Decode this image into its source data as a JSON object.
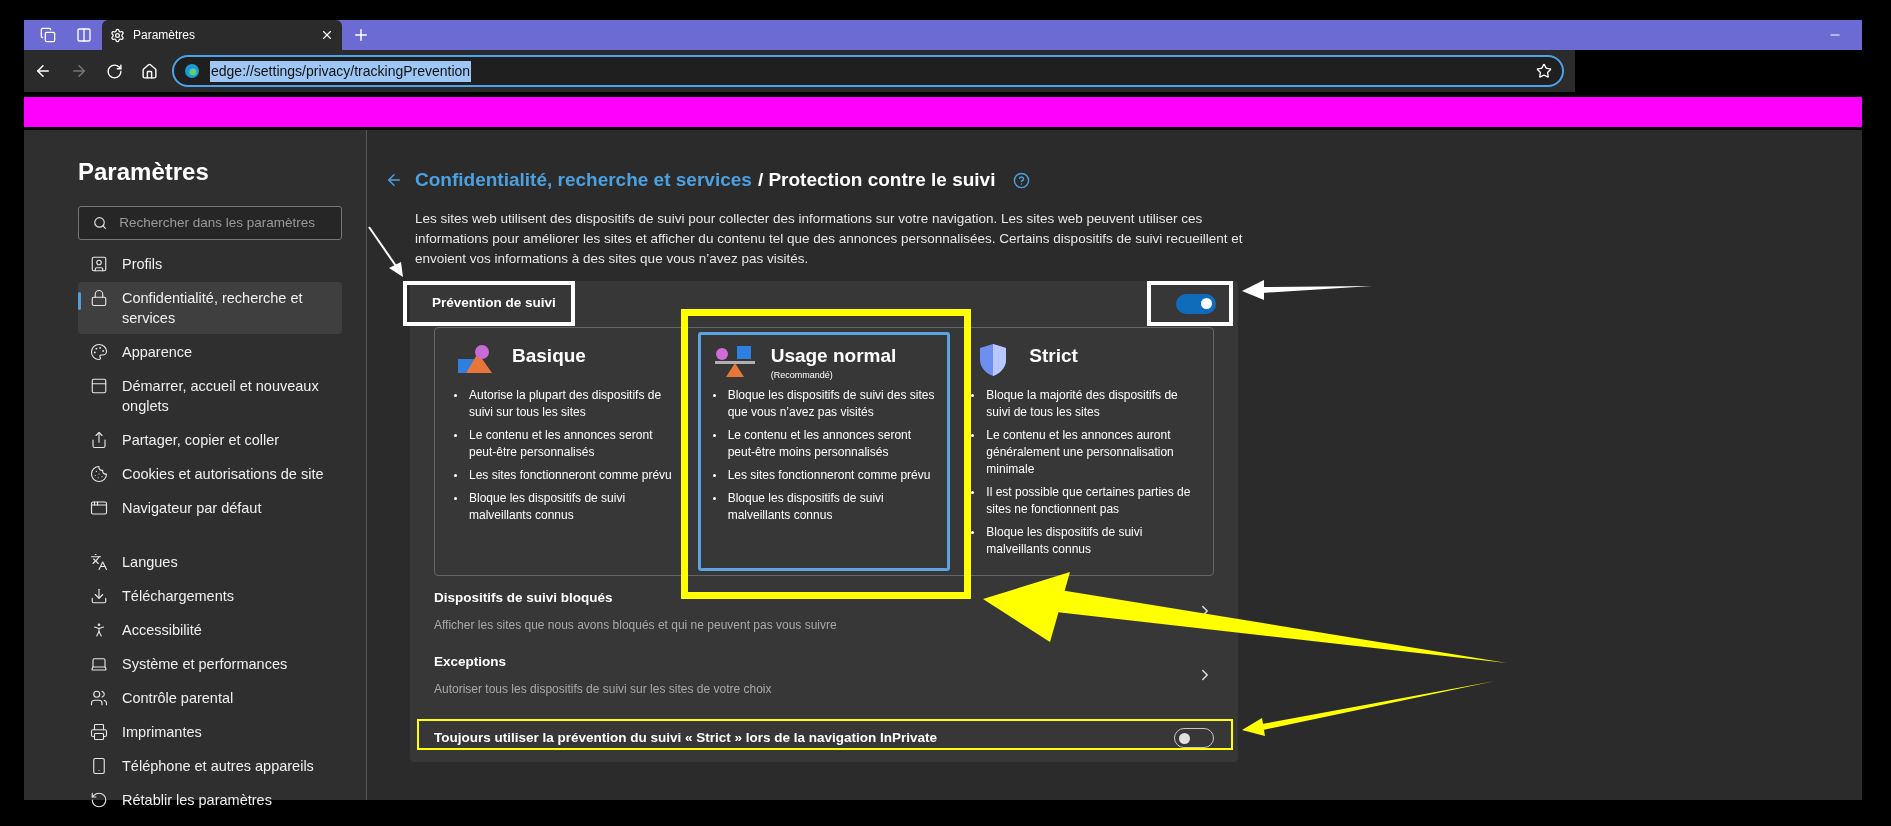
{
  "browser": {
    "tabs": [
      {
        "label": "Paramètres",
        "selected": true
      }
    ],
    "address": {
      "value": "edge://settings/privacy/trackingPrevention",
      "highlighted": true
    }
  },
  "sidebar": {
    "title": "Paramètres",
    "search": {
      "placeholder": "Rechercher dans les paramètres"
    },
    "groups": [
      [
        {
          "label": "Profils",
          "selected": false
        },
        {
          "label": "Confidentialité, recherche et services",
          "selected": true
        },
        {
          "label": "Apparence",
          "selected": false
        },
        {
          "label": "Démarrer, accueil et nouveaux onglets",
          "selected": false
        },
        {
          "label": "Partager, copier et coller",
          "selected": false
        },
        {
          "label": "Cookies et autorisations de site",
          "selected": false
        },
        {
          "label": "Navigateur par défaut",
          "selected": false
        }
      ],
      [
        {
          "label": "Langues",
          "selected": false
        },
        {
          "label": "Téléchargements",
          "selected": false
        },
        {
          "label": "Accessibilité",
          "selected": false
        },
        {
          "label": "Système et performances",
          "selected": false
        },
        {
          "label": "Contrôle parental",
          "selected": false
        },
        {
          "label": "Imprimantes",
          "selected": false
        },
        {
          "label": "Téléphone et autres appareils",
          "selected": false
        },
        {
          "label": "Rétablir les paramètres",
          "selected": false
        }
      ]
    ]
  },
  "main": {
    "breadcrumb": {
      "parent": "Confidentialité, recherche et services",
      "current": "/ Protection contre le suivi"
    },
    "description": "Les sites web utilisent des dispositifs de suivi pour collecter des informations sur votre navigation. Les sites web peuvent utiliser ces informations pour améliorer les sites et afficher du contenu tel que des annonces personnalisées. Certains dispositifs de suivi recueillent et envoient vos informations à des sites que vous n’avez pas visités.",
    "tracking": {
      "title": "Prévention de suivi",
      "on": true
    },
    "levels": [
      {
        "kind": "basic",
        "title": "Basique",
        "selected": false,
        "bullets": [
          "Autorise la plupart des dispositifs de suivi sur tous les sites",
          "Le contenu et les annonces seront peut-être personnalisés",
          "Les sites fonctionneront comme prévu",
          "Bloque les dispositifs de suivi malveillants connus"
        ]
      },
      {
        "kind": "balanced",
        "title": "Usage normal",
        "subtitle": "(Recommandé)",
        "selected": true,
        "bullets": [
          "Bloque les dispositifs de suivi des sites que vous n’avez pas visités",
          "Le contenu et les annonces seront peut-être moins personnalisés",
          "Les sites fonctionneront comme prévu",
          "Bloque les dispositifs de suivi malveillants connus"
        ]
      },
      {
        "kind": "strict",
        "title": "Strict",
        "selected": false,
        "bullets": [
          "Bloque la majorité des dispositifs de suivi de tous les sites",
          "Le contenu et les annonces auront généralement une personnalisation minimale",
          "Il est possible que certaines parties de sites ne fonctionnent pas",
          "Bloque les dispositifs de suivi malveillants connus"
        ]
      }
    ],
    "rows": [
      {
        "title": "Dispositifs de suivi bloqués",
        "description": "Afficher les sites que nous avons bloqués et qui ne peuvent pas vous suivre"
      },
      {
        "title": "Exceptions",
        "description": "Autoriser tous les dispositifs de suivi sur les sites de votre choix"
      }
    ],
    "inprivate": {
      "label": "Toujours utiliser la prévention du suivi « Strict » lors de la navigation InPrivate",
      "on": false
    }
  }
}
